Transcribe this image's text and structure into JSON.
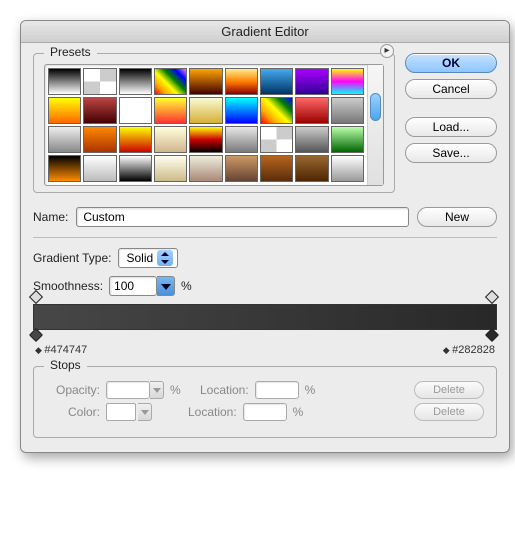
{
  "window": {
    "title": "Gradient Editor"
  },
  "buttons": {
    "ok": "OK",
    "cancel": "Cancel",
    "load": "Load...",
    "save": "Save...",
    "new": "New",
    "delete": "Delete"
  },
  "presets": {
    "legend": "Presets",
    "swatches": [
      "linear-gradient(#000,#fff)",
      "repeating-conic-gradient(#ccc 0 25%,#fff 0 50%)",
      "linear-gradient(#000,#fff)",
      "linear-gradient(45deg,red,orange,yellow,green,blue,violet)",
      "linear-gradient(orange,#400)",
      "linear-gradient(#ffec8b,#ff7f00,#8b0000)",
      "linear-gradient(#4ae,#036)",
      "linear-gradient(#a0f,#309)",
      "linear-gradient(#ff0,#f0f,#0ff)",
      "linear-gradient(#ff0,#f60)",
      "linear-gradient(#b44,#400)",
      "linear-gradient(repeating-linear-gradient(45deg,#bbb 0 4px,#eee 4px 8px))",
      "linear-gradient(#ff3,#f33)",
      "linear-gradient(#fafad2,#d4af37)",
      "linear-gradient(#0ff,#00f)",
      "linear-gradient(45deg,red,orange,yellow,green,blue)",
      "linear-gradient(#f66,#900)",
      "linear-gradient(#ccc,#777)",
      "linear-gradient(#eee,#888)",
      "linear-gradient(#f80,#a30)",
      "linear-gradient(#ff0,#c00)",
      "linear-gradient(#ffd,#d2b48c)",
      "linear-gradient(#ff0,#c00,#000)",
      "linear-gradient(#e8e8e8,#7a7a7a)",
      "repeating-conic-gradient(#ccc 0 25%,#fff 0 50%)",
      "linear-gradient(#ccc,#555)",
      "linear-gradient(#bfa,#060)",
      "linear-gradient(#000,#ff8c00)",
      "linear-gradient(#fff,#bbb)",
      "linear-gradient(#fff,#000)",
      "linear-gradient(#ffe,#cb8)",
      "linear-gradient(#eed,#a87)",
      "linear-gradient(#c96,#643)",
      "linear-gradient(#b5651d,#5a2d0c)",
      "linear-gradient(#996633,#4d2600)",
      "linear-gradient(#fff,#999)"
    ]
  },
  "nameRow": {
    "label": "Name:",
    "value": "Custom"
  },
  "gradientType": {
    "label": "Gradient Type:",
    "value": "Solid"
  },
  "smoothness": {
    "label": "Smoothness:",
    "value": "100",
    "unit": "%"
  },
  "gradient": {
    "css": "linear-gradient(to right,#474747,#282828)",
    "left_hex": "#474747",
    "right_hex": "#282828"
  },
  "stops": {
    "legend": "Stops",
    "opacity_label": "Opacity:",
    "color_label": "Color:",
    "location_label": "Location:",
    "pct": "%"
  }
}
